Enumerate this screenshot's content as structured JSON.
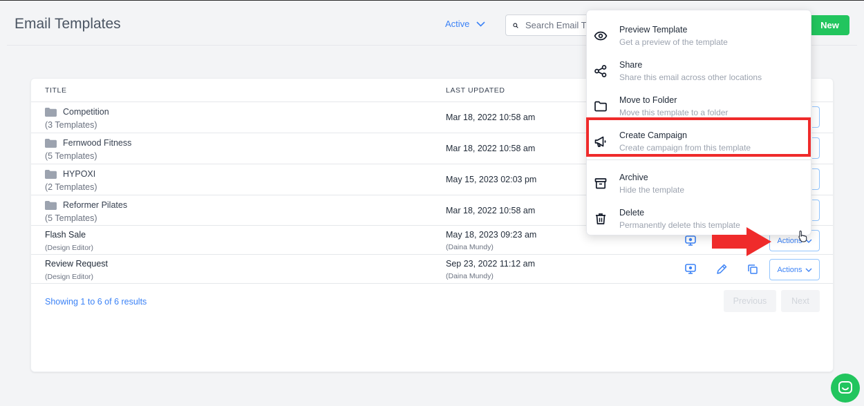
{
  "header": {
    "title": "Email Templates",
    "status_filter": "Active",
    "search_placeholder": "Search Email T",
    "new_button": "New"
  },
  "table": {
    "columns": [
      "TITLE",
      "LAST UPDATED"
    ],
    "rows": [
      {
        "type": "folder",
        "name": "Competition",
        "sub": "(3 Templates)",
        "updated": "Mar 18, 2022 10:58 am",
        "by": ""
      },
      {
        "type": "folder",
        "name": "Fernwood Fitness",
        "sub": "(5 Templates)",
        "updated": "Mar 18, 2022 10:58 am",
        "by": ""
      },
      {
        "type": "folder",
        "name": "HYPOXI",
        "sub": "(2 Templates)",
        "updated": "May 15, 2023 02:03 pm",
        "by": ""
      },
      {
        "type": "folder",
        "name": "Reformer Pilates",
        "sub": "(5 Templates)",
        "updated": "Mar 18, 2022 10:58 am",
        "by": ""
      },
      {
        "type": "template",
        "name": "Flash Sale",
        "sub": "(Design Editor)",
        "updated": "May 18, 2023 09:23 am",
        "by": "(Daina Mundy)",
        "actions": "Actions"
      },
      {
        "type": "template",
        "name": "Review Request",
        "sub": "(Design Editor)",
        "updated": "Sep 23, 2022 11:12 am",
        "by": "(Daina Mundy)",
        "actions": "Actions"
      }
    ],
    "results_text": "Showing 1 to 6 of 6 results",
    "previous": "Previous",
    "next": "Next"
  },
  "menu": {
    "items": [
      {
        "label": "Preview Template",
        "desc": "Get a preview of the template",
        "icon": "eye-icon"
      },
      {
        "label": "Share",
        "desc": "Share this email across other locations",
        "icon": "share-icon"
      },
      {
        "label": "Move to Folder",
        "desc": "Move this template to a folder",
        "icon": "folder-icon"
      },
      {
        "label": "Create Campaign",
        "desc": "Create campaign from this template",
        "icon": "megaphone-icon"
      },
      {
        "label": "Archive",
        "desc": "Hide the template",
        "icon": "archive-icon"
      },
      {
        "label": "Delete",
        "desc": "Permanently delete this template",
        "icon": "trash-icon"
      }
    ]
  },
  "colors": {
    "accent": "#3b82f6",
    "new_button": "#22c55e",
    "highlight": "#ef2b2b"
  }
}
